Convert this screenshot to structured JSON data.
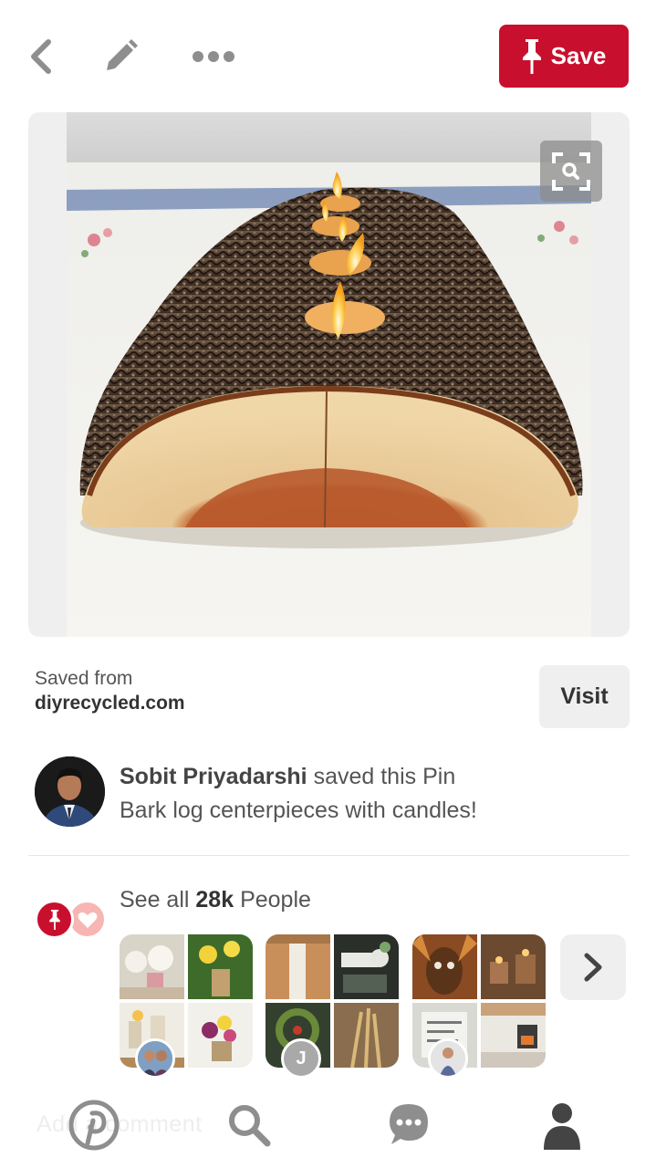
{
  "toolbar": {
    "save_label": "Save",
    "icons": [
      "back-chevron-icon",
      "pencil-icon",
      "more-dots-icon",
      "pushpin-icon"
    ]
  },
  "pin": {
    "image_alt": "Bark log centerpiece with candles",
    "lens_icon": "visual-search-icon"
  },
  "source": {
    "label": "Saved from",
    "domain": "diyrecycled.com",
    "visit_label": "Visit"
  },
  "saver": {
    "name": "Sobit Priyadarshi",
    "action": "saved this Pin",
    "description": "Bark log centerpieces with candles!"
  },
  "people": {
    "prefix": "See all",
    "count": "28k",
    "suffix": "People",
    "boards": [
      {
        "avatar_letter": ""
      },
      {
        "avatar_letter": "J"
      },
      {
        "avatar_letter": ""
      }
    ]
  },
  "bottom_nav": {
    "ghost_text": "Add a comment",
    "items": [
      "pinterest-logo-icon",
      "search-icon",
      "messages-icon",
      "profile-icon"
    ]
  },
  "colors": {
    "brand_red": "#c8102e",
    "button_gray": "#efefef",
    "icon_gray": "#8e8e8e",
    "text_dark": "#333333"
  }
}
